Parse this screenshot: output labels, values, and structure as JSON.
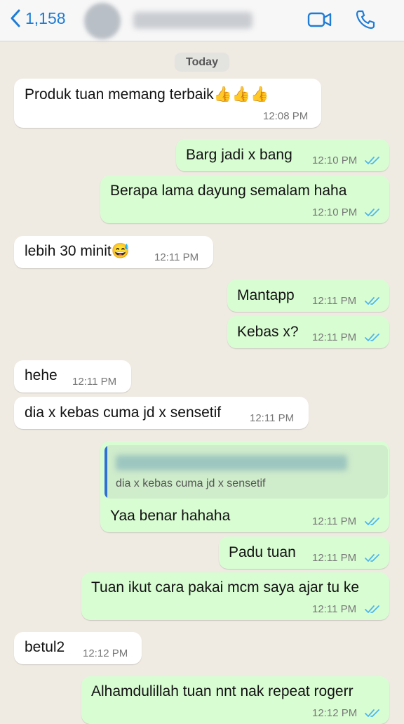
{
  "header": {
    "back_count": "1,158",
    "back_icon": "chevron-left-icon",
    "video_icon": "video-call-icon",
    "call_icon": "phone-icon",
    "accent_color": "#1e7cd6"
  },
  "date_divider": "Today",
  "messages": [
    {
      "dir": "in",
      "text": "Produk tuan memang terbaik👍👍👍",
      "time": "12:08 PM"
    },
    {
      "dir": "out",
      "text": "Barg jadi x bang",
      "time": "12:10 PM"
    },
    {
      "dir": "out",
      "text": "Berapa lama dayung semalam haha",
      "time": "12:10 PM"
    },
    {
      "dir": "in",
      "text": "lebih 30 minit😅",
      "time": "12:11 PM"
    },
    {
      "dir": "out",
      "text": "Mantapp",
      "time": "12:11 PM"
    },
    {
      "dir": "out",
      "text": "Kebas x?",
      "time": "12:11 PM"
    },
    {
      "dir": "in",
      "text": "hehe",
      "time": "12:11 PM"
    },
    {
      "dir": "in",
      "text": "dia x kebas cuma jd x sensetif",
      "time": "12:11 PM"
    },
    {
      "dir": "out",
      "text": "Yaa benar hahaha",
      "time": "12:11 PM",
      "quote": "dia x kebas cuma jd x sensetif"
    },
    {
      "dir": "out",
      "text": "Padu tuan",
      "time": "12:11 PM"
    },
    {
      "dir": "out",
      "text": "Tuan ikut cara pakai mcm saya ajar tu ke",
      "time": "12:11 PM"
    },
    {
      "dir": "in",
      "text": "betul2",
      "time": "12:12 PM"
    },
    {
      "dir": "out",
      "text": "Alhamdulillah tuan nnt nak repeat rogerr",
      "time": "12:12 PM"
    }
  ],
  "colors": {
    "incoming_bubble": "#ffffff",
    "outgoing_bubble": "#d9fdd3",
    "read_ticks": "#4fb6ec",
    "background": "#efeae2"
  }
}
